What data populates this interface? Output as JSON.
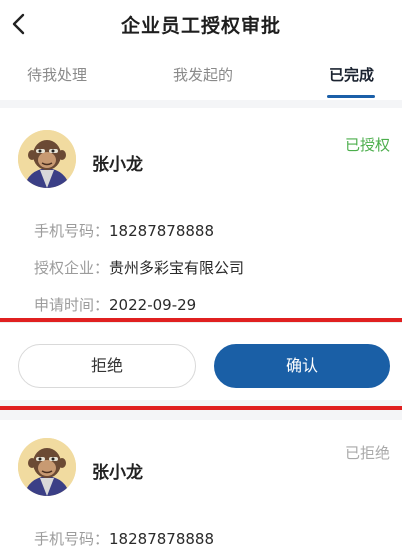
{
  "header": {
    "title": "企业员工授权审批",
    "back_icon": "chevron-left-icon"
  },
  "tabs": [
    {
      "label": "待我处理",
      "active": false
    },
    {
      "label": "我发起的",
      "active": false
    },
    {
      "label": "已完成",
      "active": true
    }
  ],
  "records": [
    {
      "name": "张小龙",
      "status": "已授权",
      "status_color": "#4cae4c",
      "fields": [
        {
          "label": "手机号码：",
          "value": "18287878888"
        },
        {
          "label": "授权企业：",
          "value": "贵州多彩宝有限公司"
        },
        {
          "label": "申请时间：",
          "value": "2022-09-29"
        }
      ],
      "actions": {
        "reject_label": "拒绝",
        "confirm_label": "确认"
      }
    },
    {
      "name": "张小龙",
      "status": "已拒绝",
      "status_color": "#a9a9a9",
      "fields": [
        {
          "label": "手机号码：",
          "value": "18287878888"
        }
      ]
    }
  ],
  "colors": {
    "accent": "#1a5fa6",
    "highlight_frame": "#e02020"
  }
}
